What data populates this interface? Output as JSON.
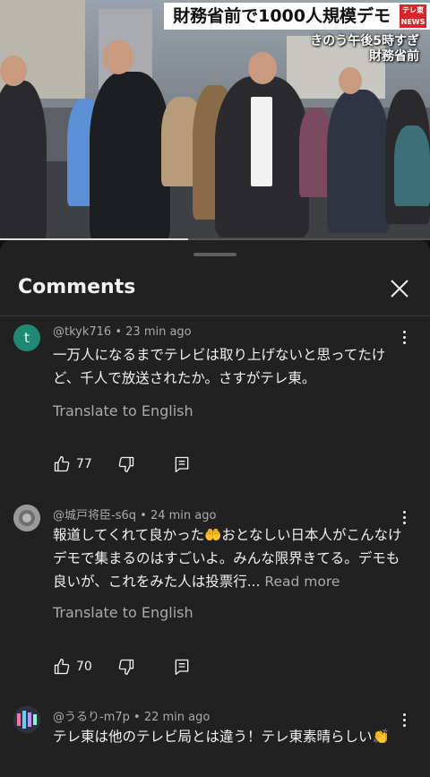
{
  "video": {
    "headline": "財務省前で1000人規模デモ",
    "channel_logo": "テレ東 NEWS",
    "subtitle_line1": "きのう午後5時すぎ",
    "subtitle_line2": "財務省前"
  },
  "comments_panel": {
    "title": "Comments",
    "translate_label": "Translate to English",
    "colors": {
      "sheet_bg": "#212121",
      "muted": "#aaaaaa",
      "avatar_t": "#1e8a73"
    },
    "comments": [
      {
        "author": "@tkyk716",
        "time": "23 min ago",
        "avatar_letter": "t",
        "text": "一万人になるまでテレビは取り上げないと思ってたけど、千人で放送されたか。さすがテレ東。",
        "likes": "77"
      },
      {
        "author": "@城戸将臣-s6q",
        "time": "24 min ago",
        "text": "報道してくれて良かった🤲おとなしい日本人がこんなけデモで集まるのはすごいよ。みんな限界きてる。デモも良いが、これをみた人は投票行...",
        "read_more": "Read more",
        "likes": "70"
      },
      {
        "author": "@うるり-m7p",
        "time": "22 min ago",
        "text": "テレ東は他のテレビ局とは違う！テレ東素晴らしい👏"
      }
    ]
  }
}
